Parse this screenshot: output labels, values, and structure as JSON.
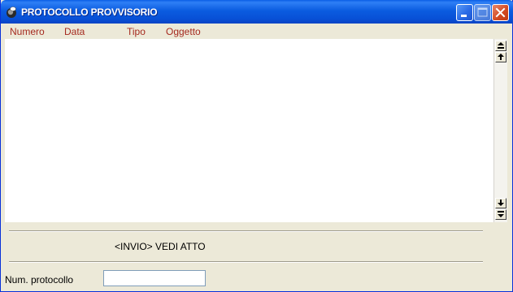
{
  "window": {
    "title": "PROTOCOLLO PROVVISORIO"
  },
  "titlebar_buttons": {
    "minimize_icon": "minimize-icon",
    "maximize_icon": "maximize-icon",
    "close_icon": "close-icon"
  },
  "list": {
    "columns": [
      "Numero",
      "Data",
      "Tipo",
      "Oggetto"
    ],
    "rows": []
  },
  "scrollbar_icons": [
    "scroll-top-icon",
    "scroll-up-icon",
    "scroll-down-icon",
    "scroll-bottom-icon"
  ],
  "hint": {
    "text": "<INVIO> VEDI ATTO"
  },
  "form": {
    "protocol_label": "Num. protocollo",
    "protocol_value": ""
  },
  "colors": {
    "header_text": "#A52A1F",
    "titlebar": "#0850D6",
    "window_bg": "#ECE9D8"
  }
}
